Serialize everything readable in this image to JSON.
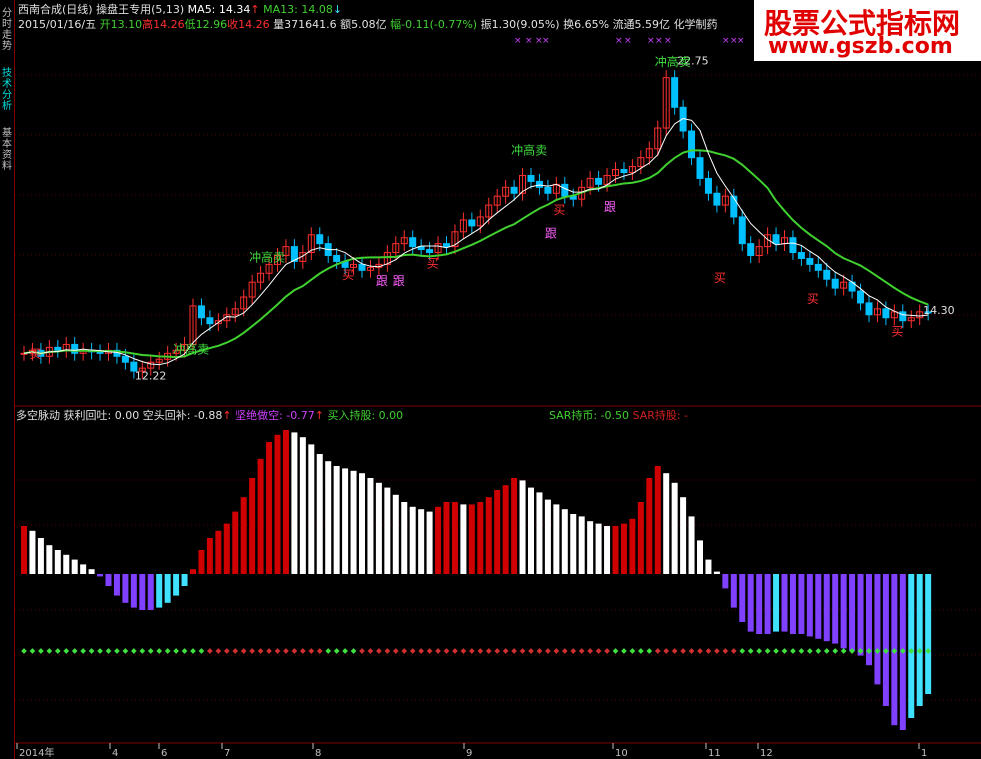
{
  "sidebar": {
    "tabs": [
      "分时走势",
      "技术分析",
      "基本资料"
    ]
  },
  "header": {
    "line1": {
      "stock": "西南合成(日线)",
      "indicator": "操盘王专用(5,13)",
      "ma5_label": "MA5: 14.34",
      "ma13_label": "MA13: 14.08"
    },
    "line2": {
      "date": "2015/01/16/五",
      "open": "开13.10",
      "high": "高14.26",
      "low": "低12.96",
      "close": "收14.26",
      "volume": "量371641.6",
      "amount": "额5.08亿",
      "change": "幅-0.11(-0.77%)",
      "amplitude": "振1.30(9.05%)",
      "turnover": "换6.65%",
      "float": "流通5.59亿",
      "sector": "化学制药"
    }
  },
  "banner": {
    "title": "股票公式指标网",
    "url": "www.gszb.com"
  },
  "indicator_header": {
    "name": "多空脉动",
    "profit": "获利回吐: 0.00",
    "short_cover": "空头回补: -0.88",
    "short": "坚绝做空: -0.77",
    "buy": "买入持股: 0.00",
    "sar_coin": "SAR持币: -0.50",
    "sar_hold": "SAR持股: -"
  },
  "x_axis": {
    "labels": [
      "2014年",
      "4",
      "6",
      "7",
      "8",
      "9",
      "10",
      "11",
      "12",
      "1"
    ]
  },
  "colors": {
    "up": "#ff3030",
    "down": "#00c0ff",
    "ma13": "#40d030",
    "ma5": "#ffffff",
    "bull": "#d00000",
    "bear": "#8040ff",
    "cyan": "#40e0ff"
  },
  "chart_data": {
    "type": "candlestick",
    "price_labels": {
      "high": "22.75",
      "low": "12.22",
      "last": "14.30"
    },
    "annotations": [
      {
        "text": "冲高卖",
        "kind": "sell"
      },
      {
        "text": "冲高卖",
        "kind": "sell"
      },
      {
        "text": "冲高卖",
        "kind": "sell"
      },
      {
        "text": "冲高卖",
        "kind": "sell"
      },
      {
        "text": "买",
        "kind": "buy"
      },
      {
        "text": "买",
        "kind": "buy"
      },
      {
        "text": "跟",
        "kind": "follow"
      },
      {
        "text": "跟",
        "kind": "follow"
      },
      {
        "text": "买",
        "kind": "buy"
      },
      {
        "text": "买",
        "kind": "buy"
      },
      {
        "text": "跟",
        "kind": "follow"
      },
      {
        "text": "跟",
        "kind": "follow"
      },
      {
        "text": "买",
        "kind": "buy"
      },
      {
        "text": "买",
        "kind": "buy"
      },
      {
        "text": "买",
        "kind": "buy"
      }
    ],
    "closes": [
      12.9,
      13.0,
      12.8,
      13.1,
      13.0,
      13.2,
      12.9,
      13.0,
      12.95,
      12.9,
      13.0,
      12.8,
      12.6,
      12.3,
      12.4,
      12.6,
      12.7,
      12.9,
      13.0,
      13.2,
      14.5,
      14.1,
      13.9,
      14.0,
      14.2,
      14.4,
      14.8,
      15.3,
      15.6,
      15.9,
      16.2,
      16.5,
      16.0,
      16.3,
      16.9,
      16.6,
      16.2,
      16.0,
      15.8,
      15.9,
      15.7,
      15.8,
      15.9,
      16.3,
      16.6,
      16.8,
      16.5,
      16.4,
      16.3,
      16.6,
      16.5,
      17.0,
      17.4,
      17.2,
      17.5,
      17.9,
      18.2,
      18.5,
      18.3,
      18.9,
      18.7,
      18.5,
      18.3,
      18.6,
      18.2,
      18.1,
      18.5,
      18.8,
      18.6,
      18.9,
      19.1,
      19.0,
      19.2,
      19.5,
      19.8,
      20.5,
      22.2,
      21.2,
      20.4,
      19.5,
      18.8,
      18.3,
      17.9,
      18.2,
      17.5,
      16.6,
      16.2,
      16.5,
      16.9,
      16.6,
      16.8,
      16.3,
      16.1,
      15.9,
      15.7,
      15.4,
      15.1,
      15.3,
      15.0,
      14.6,
      14.2,
      14.4,
      14.1,
      14.3,
      14.0,
      14.1,
      14.3,
      14.26
    ],
    "histogram": [
      0.2,
      0.18,
      0.15,
      0.12,
      0.1,
      0.08,
      0.06,
      0.04,
      0.02,
      -0.01,
      -0.05,
      -0.09,
      -0.12,
      -0.14,
      -0.15,
      -0.15,
      -0.14,
      -0.12,
      -0.09,
      -0.05,
      0.02,
      0.1,
      0.15,
      0.18,
      0.21,
      0.26,
      0.32,
      0.4,
      0.48,
      0.55,
      0.58,
      0.6,
      0.59,
      0.57,
      0.54,
      0.5,
      0.47,
      0.45,
      0.44,
      0.43,
      0.42,
      0.4,
      0.38,
      0.36,
      0.33,
      0.3,
      0.28,
      0.27,
      0.26,
      0.28,
      0.3,
      0.3,
      0.29,
      0.29,
      0.3,
      0.32,
      0.35,
      0.37,
      0.4,
      0.39,
      0.36,
      0.34,
      0.31,
      0.29,
      0.27,
      0.25,
      0.24,
      0.22,
      0.21,
      0.2,
      0.2,
      0.21,
      0.23,
      0.3,
      0.4,
      0.45,
      0.42,
      0.38,
      0.32,
      0.24,
      0.14,
      0.06,
      0.01,
      -0.06,
      -0.14,
      -0.2,
      -0.24,
      -0.25,
      -0.25,
      -0.24,
      -0.24,
      -0.25,
      -0.25,
      -0.26,
      -0.27,
      -0.28,
      -0.29,
      -0.31,
      -0.32,
      -0.34,
      -0.38,
      -0.46,
      -0.55,
      -0.63,
      -0.65,
      -0.6,
      -0.55,
      -0.5
    ]
  }
}
